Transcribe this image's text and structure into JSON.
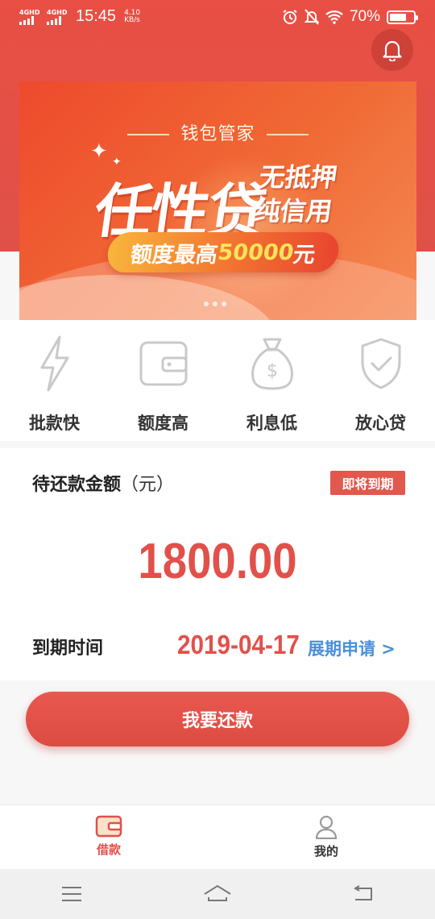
{
  "status_bar": {
    "signal1": "4GHD",
    "signal2": "4GHD",
    "time": "15:45",
    "speed_value": "4.10",
    "speed_unit": "KB/s",
    "battery_pct": "70%",
    "battery_level": 0.7
  },
  "header": {
    "bell_icon": "bell-icon"
  },
  "banner": {
    "subtitle": "钱包管家",
    "main_title": "任性贷",
    "side_line1": "无抵押",
    "side_line2": "纯信用",
    "pill_prefix": "额度最高",
    "pill_amount": "50000",
    "pill_suffix": "元",
    "pages": 3
  },
  "features": [
    {
      "icon": "lightning-icon",
      "label": "批款快"
    },
    {
      "icon": "wallet-icon",
      "label": "额度高"
    },
    {
      "icon": "money-bag-icon",
      "label": "利息低"
    },
    {
      "icon": "shield-check-icon",
      "label": "放心贷"
    }
  ],
  "repayment": {
    "title": "待还款金额",
    "unit": "（元）",
    "badge": "即将到期",
    "amount": "1800.00",
    "due_label": "到期时间",
    "due_date": "2019-04-17",
    "extend_label": "展期申请 >"
  },
  "cta": {
    "label": "我要还款"
  },
  "tabs": [
    {
      "icon": "wallet-icon",
      "label": "借款",
      "active": true
    },
    {
      "icon": "person-icon",
      "label": "我的",
      "active": false
    }
  ],
  "colors": {
    "accent": "#e2504a",
    "link": "#4a90d9",
    "header": "#e94f44"
  }
}
